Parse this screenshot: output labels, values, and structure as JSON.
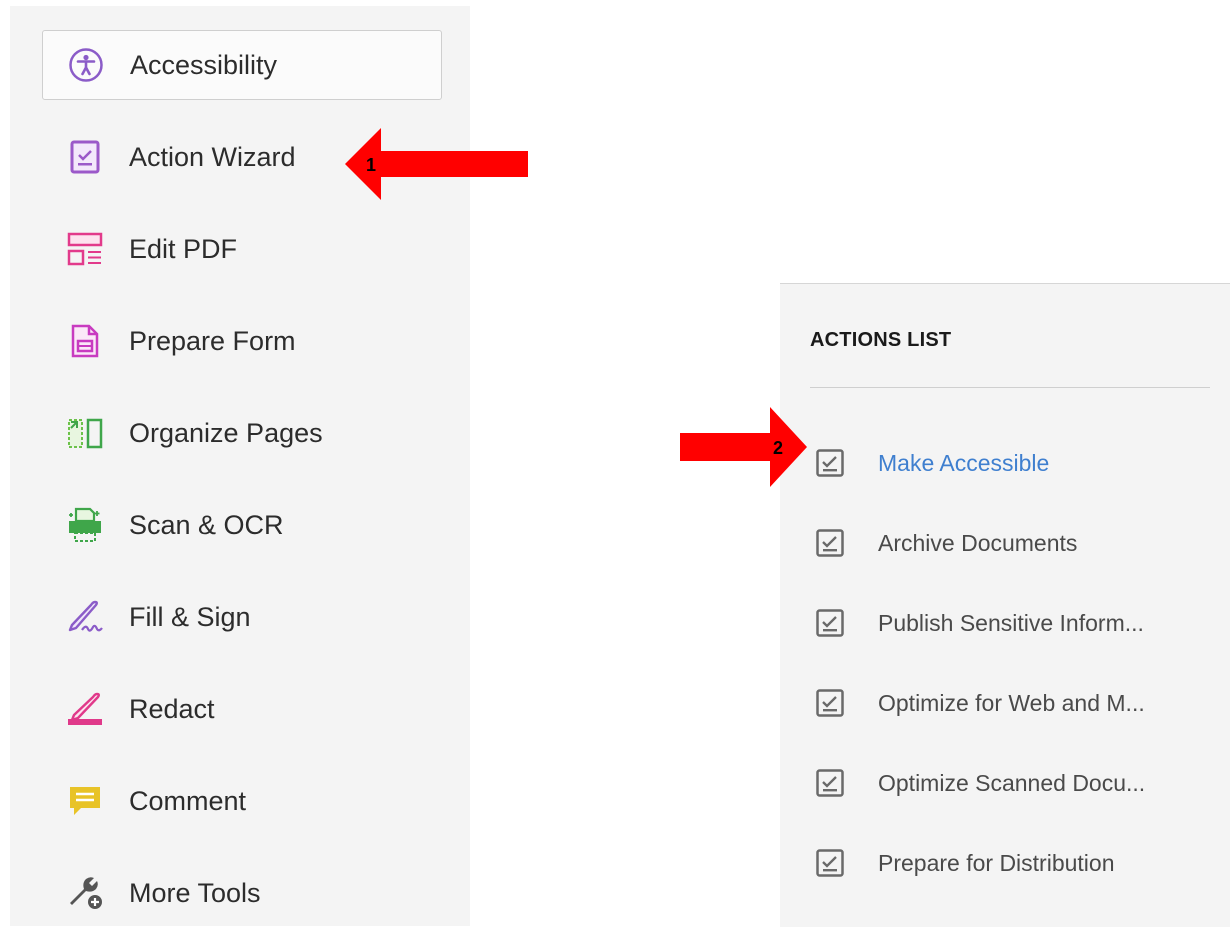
{
  "tools": {
    "items": [
      {
        "label": "Accessibility",
        "icon": "accessibility-icon",
        "color": "#8b5cc8"
      },
      {
        "label": "Action Wizard",
        "icon": "action-wizard-icon",
        "color": "#9b59c9"
      },
      {
        "label": "Edit PDF",
        "icon": "edit-pdf-icon",
        "color": "#e23a8b"
      },
      {
        "label": "Prepare Form",
        "icon": "prepare-form-icon",
        "color": "#c83bc0"
      },
      {
        "label": "Organize Pages",
        "icon": "organize-pages-icon",
        "color": "#6cc24a"
      },
      {
        "label": "Scan & OCR",
        "icon": "scan-ocr-icon",
        "color": "#3fa64a"
      },
      {
        "label": "Fill & Sign",
        "icon": "fill-sign-icon",
        "color": "#8b5cc8"
      },
      {
        "label": "Redact",
        "icon": "redact-icon",
        "color": "#e0398a"
      },
      {
        "label": "Comment",
        "icon": "comment-icon",
        "color": "#e8c327"
      },
      {
        "label": "More Tools",
        "icon": "more-tools-icon",
        "color": "#555555"
      }
    ]
  },
  "actions": {
    "title": "ACTIONS LIST",
    "items": [
      {
        "label": "Make Accessible"
      },
      {
        "label": "Archive Documents"
      },
      {
        "label": "Publish Sensitive Inform..."
      },
      {
        "label": "Optimize for Web and M..."
      },
      {
        "label": "Optimize Scanned Docu..."
      },
      {
        "label": "Prepare for Distribution"
      }
    ]
  },
  "annotations": {
    "arrow1_number": "1",
    "arrow2_number": "2",
    "arrow_color": "#ff0000"
  }
}
